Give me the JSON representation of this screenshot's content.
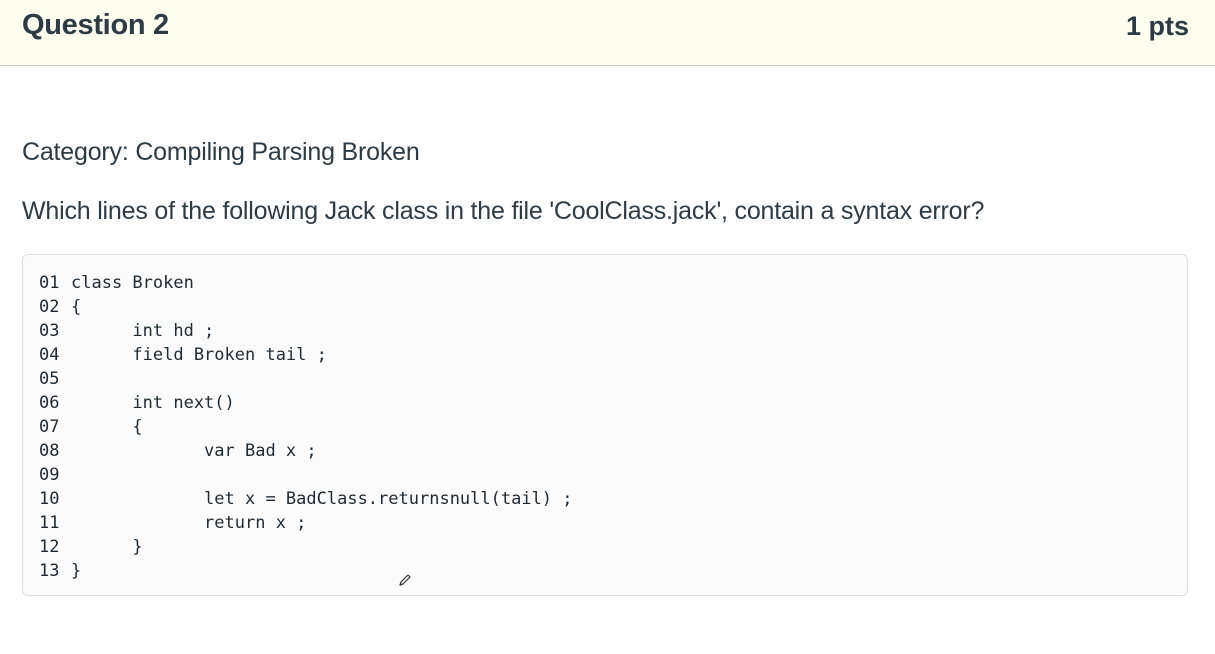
{
  "question": {
    "title": "Question 2",
    "points": "1 pts",
    "category": "Category: Compiling Parsing Broken",
    "prompt": "Which lines of the following Jack class in the file 'CoolClass.jack', contain a syntax error?"
  },
  "code": {
    "lines": [
      {
        "no": "01",
        "text": "class Broken"
      },
      {
        "no": "02",
        "text": "{"
      },
      {
        "no": "03",
        "text": "      int hd ;"
      },
      {
        "no": "04",
        "text": "      field Broken tail ;"
      },
      {
        "no": "05",
        "text": ""
      },
      {
        "no": "06",
        "text": "      int next()"
      },
      {
        "no": "07",
        "text": "      {"
      },
      {
        "no": "08",
        "text": "             var Bad x ;"
      },
      {
        "no": "09",
        "text": ""
      },
      {
        "no": "10",
        "text": "             let x = BadClass.returnsnull(tail) ;"
      },
      {
        "no": "11",
        "text": "             return x ;"
      },
      {
        "no": "12",
        "text": "      }"
      },
      {
        "no": "13",
        "text": "}"
      }
    ]
  },
  "cursor": {
    "icon": "pen-cursor-icon"
  }
}
